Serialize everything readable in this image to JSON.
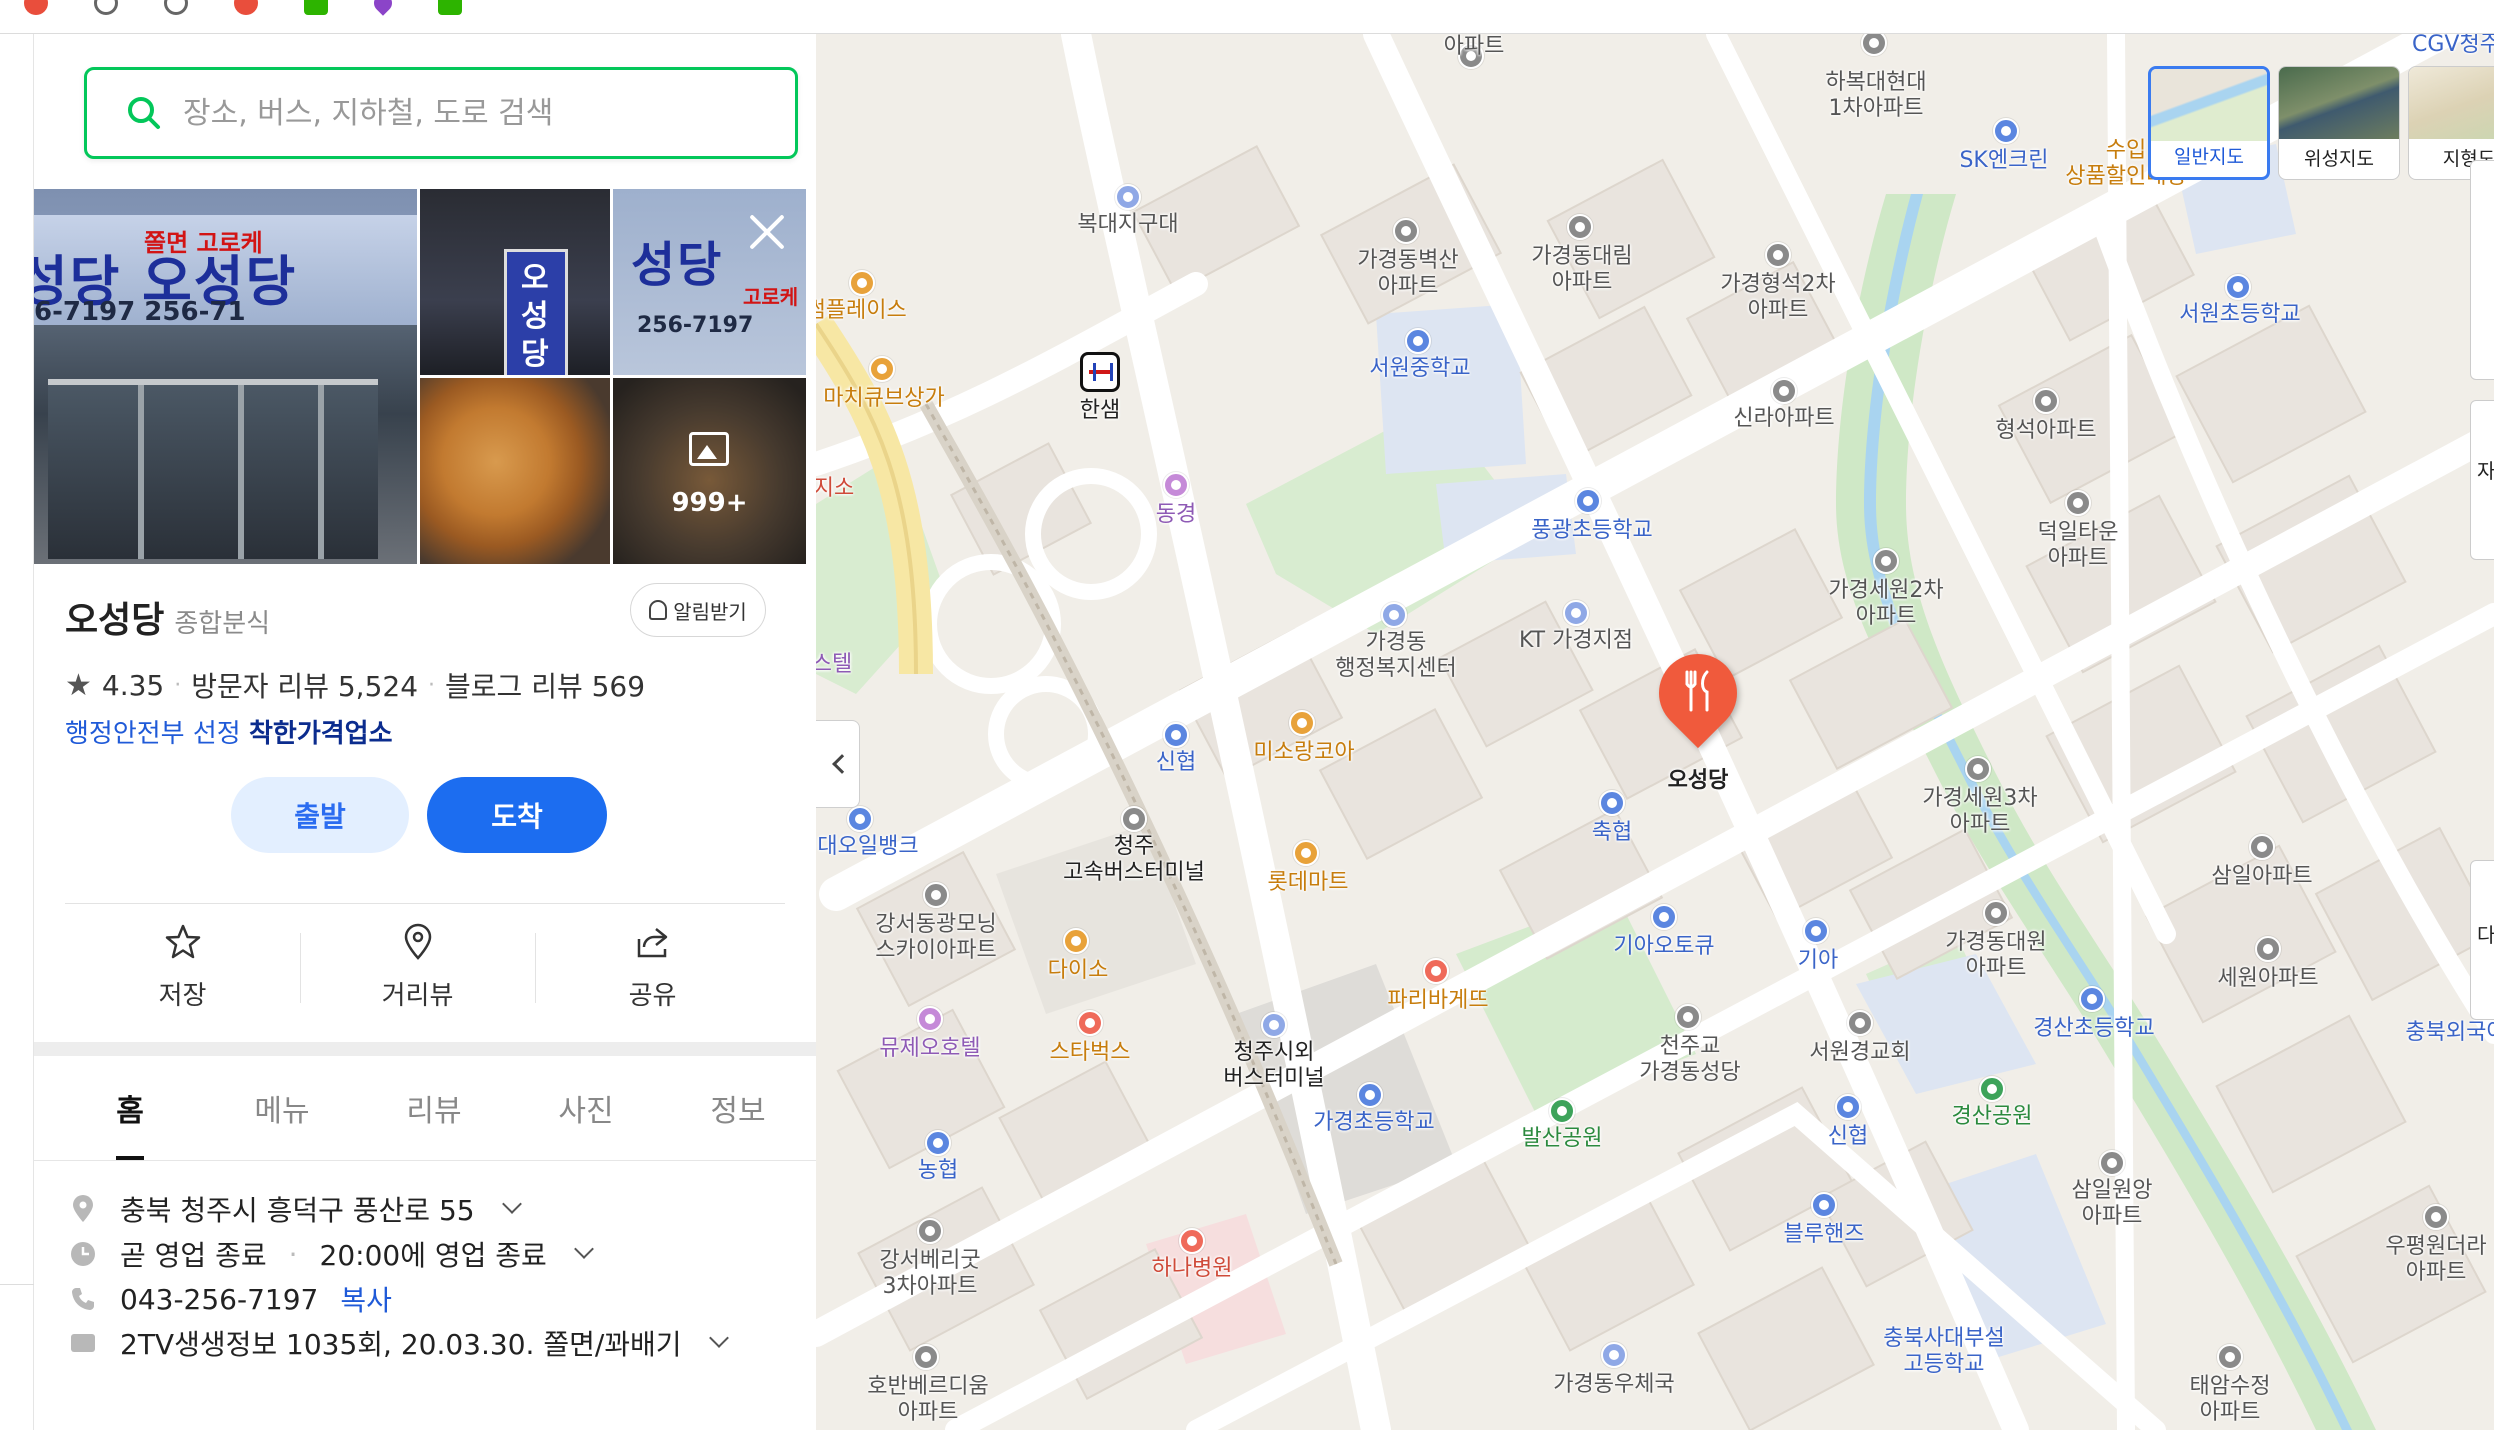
{
  "bookmarks": [
    "",
    "",
    "",
    "",
    "",
    "",
    ""
  ],
  "search": {
    "placeholder": "장소, 버스, 지하철, 도로 검색"
  },
  "place": {
    "photo_count": "999+",
    "name": "오성당",
    "category": "종합분식",
    "alarm_label": "알림받기",
    "rating": "4.35",
    "visitor_reviews": "방문자 리뷰 5,524",
    "blog_reviews": "블로그 리뷰 569",
    "badge_prefix": "행정안전부 선정",
    "badge_name": "착한가격업소",
    "depart_label": "출발",
    "arrive_label": "도착",
    "actions": [
      {
        "label": "저장",
        "icon": "star-icon"
      },
      {
        "label": "거리뷰",
        "icon": "pin-outline-icon"
      },
      {
        "label": "공유",
        "icon": "share-icon"
      }
    ],
    "tabs": [
      "홈",
      "메뉴",
      "리뷰",
      "사진",
      "정보"
    ],
    "active_tab": "홈",
    "address": "충북 청주시 흥덕구 풍산로 55",
    "hours_status": "곧 영업 종료",
    "hours_detail": "20:00에 영업 종료",
    "phone": "043-256-7197",
    "copy_label": "복사",
    "tv_info": "2TV생생정보 1035회, 20.03.30. 쫄면/꽈배기"
  },
  "photo_signs": {
    "main_title": "성당 오성당",
    "main_sub": "쫄면 고로케",
    "main_phone": "6-7197 256-71",
    "side_title": "성당",
    "side_sub": "고로케",
    "side_phone": "256-7197",
    "vertical": "오성당"
  },
  "map": {
    "target_label": "오성당",
    "layers": [
      {
        "label": "일반지도",
        "active": true
      },
      {
        "label": "위성지도",
        "active": false
      },
      {
        "label": "지형도",
        "active": false
      }
    ],
    "partial_labels": [
      "자",
      "다"
    ],
    "labels": [
      {
        "text": "아파트",
        "color": "gray"
      },
      {
        "text": "하복대현대\n1차아파트",
        "color": "gray"
      },
      {
        "text": "SK엔크린",
        "color": "blue"
      },
      {
        "text": "수입\n상품할인매장",
        "color": "orange"
      },
      {
        "text": "복대지구대",
        "color": "gray"
      },
      {
        "text": "가경동벽산\n아파트",
        "color": "gray"
      },
      {
        "text": "가경동대림\n아파트",
        "color": "gray"
      },
      {
        "text": "가경형석2차\n아파트",
        "color": "gray"
      },
      {
        "text": "서원초등학교",
        "color": "blue"
      },
      {
        "text": "롯썸플레이스",
        "color": "orange"
      },
      {
        "text": "마치큐브상가",
        "color": "orange"
      },
      {
        "text": "한샘",
        "color": "dark"
      },
      {
        "text": "서원중학교",
        "color": "blue"
      },
      {
        "text": "신라아파트",
        "color": "gray"
      },
      {
        "text": "형석아파트",
        "color": "gray"
      },
      {
        "text": "지소",
        "color": "red"
      },
      {
        "text": "동경",
        "color": "purple"
      },
      {
        "text": "풍광초등학교",
        "color": "blue"
      },
      {
        "text": "덕일타운\n아파트",
        "color": "gray"
      },
      {
        "text": "가경세원2차\n아파트",
        "color": "gray"
      },
      {
        "text": "KT 가경지점",
        "color": "gray"
      },
      {
        "text": "가경동\n행정복지센터",
        "color": "gray"
      },
      {
        "text": "스텔",
        "color": "purple"
      },
      {
        "text": "신협",
        "color": "blue"
      },
      {
        "text": "미소랑코아",
        "color": "orange"
      },
      {
        "text": "축협",
        "color": "blue"
      },
      {
        "text": "가경세원3차\n아파트",
        "color": "gray"
      },
      {
        "text": "대오일뱅크",
        "color": "blue"
      },
      {
        "text": "청주\n고속버스터미널",
        "color": "dark"
      },
      {
        "text": "롯데마트",
        "color": "orange"
      },
      {
        "text": "삼일아파트",
        "color": "gray"
      },
      {
        "text": "강서동광모닝\n스카이아파트",
        "color": "gray"
      },
      {
        "text": "다이소",
        "color": "orange"
      },
      {
        "text": "기아오토큐",
        "color": "blue"
      },
      {
        "text": "기아",
        "color": "blue"
      },
      {
        "text": "가경동대원\n아파트",
        "color": "gray"
      },
      {
        "text": "세원아파트",
        "color": "gray"
      },
      {
        "text": "파리바게뜨",
        "color": "orange"
      },
      {
        "text": "충북외국어",
        "color": "blue"
      },
      {
        "text": "뮤제오호텔",
        "color": "purple"
      },
      {
        "text": "스타벅스",
        "color": "orange"
      },
      {
        "text": "청주시외\n버스터미널",
        "color": "dark"
      },
      {
        "text": "천주교\n가경동성당",
        "color": "gray"
      },
      {
        "text": "서원경교회",
        "color": "gray"
      },
      {
        "text": "경산초등학교",
        "color": "blue"
      },
      {
        "text": "경산공원",
        "color": "green"
      },
      {
        "text": "가경초등학교",
        "color": "blue"
      },
      {
        "text": "발산공원",
        "color": "green"
      },
      {
        "text": "농협",
        "color": "blue"
      },
      {
        "text": "신협",
        "color": "blue"
      },
      {
        "text": "삼일원앙\n아파트",
        "color": "gray"
      },
      {
        "text": "우평원더라\n아파트",
        "color": "gray"
      },
      {
        "text": "강서베리굿\n3차아파트",
        "color": "gray"
      },
      {
        "text": "하나병원",
        "color": "red"
      },
      {
        "text": "블루핸즈",
        "color": "blue"
      },
      {
        "text": "충북사대부설\n고등학교",
        "color": "blue"
      },
      {
        "text": "호반베르디움\n아파트",
        "color": "gray"
      },
      {
        "text": "가경동우체국",
        "color": "gray"
      },
      {
        "text": "태암수정\n아파트",
        "color": "gray"
      },
      {
        "text": "CGV청주",
        "color": "blue"
      }
    ]
  },
  "colors": {
    "brand_green": "#03c75a",
    "primary_blue": "#1c6df0",
    "pin_red": "#f05a3c"
  }
}
